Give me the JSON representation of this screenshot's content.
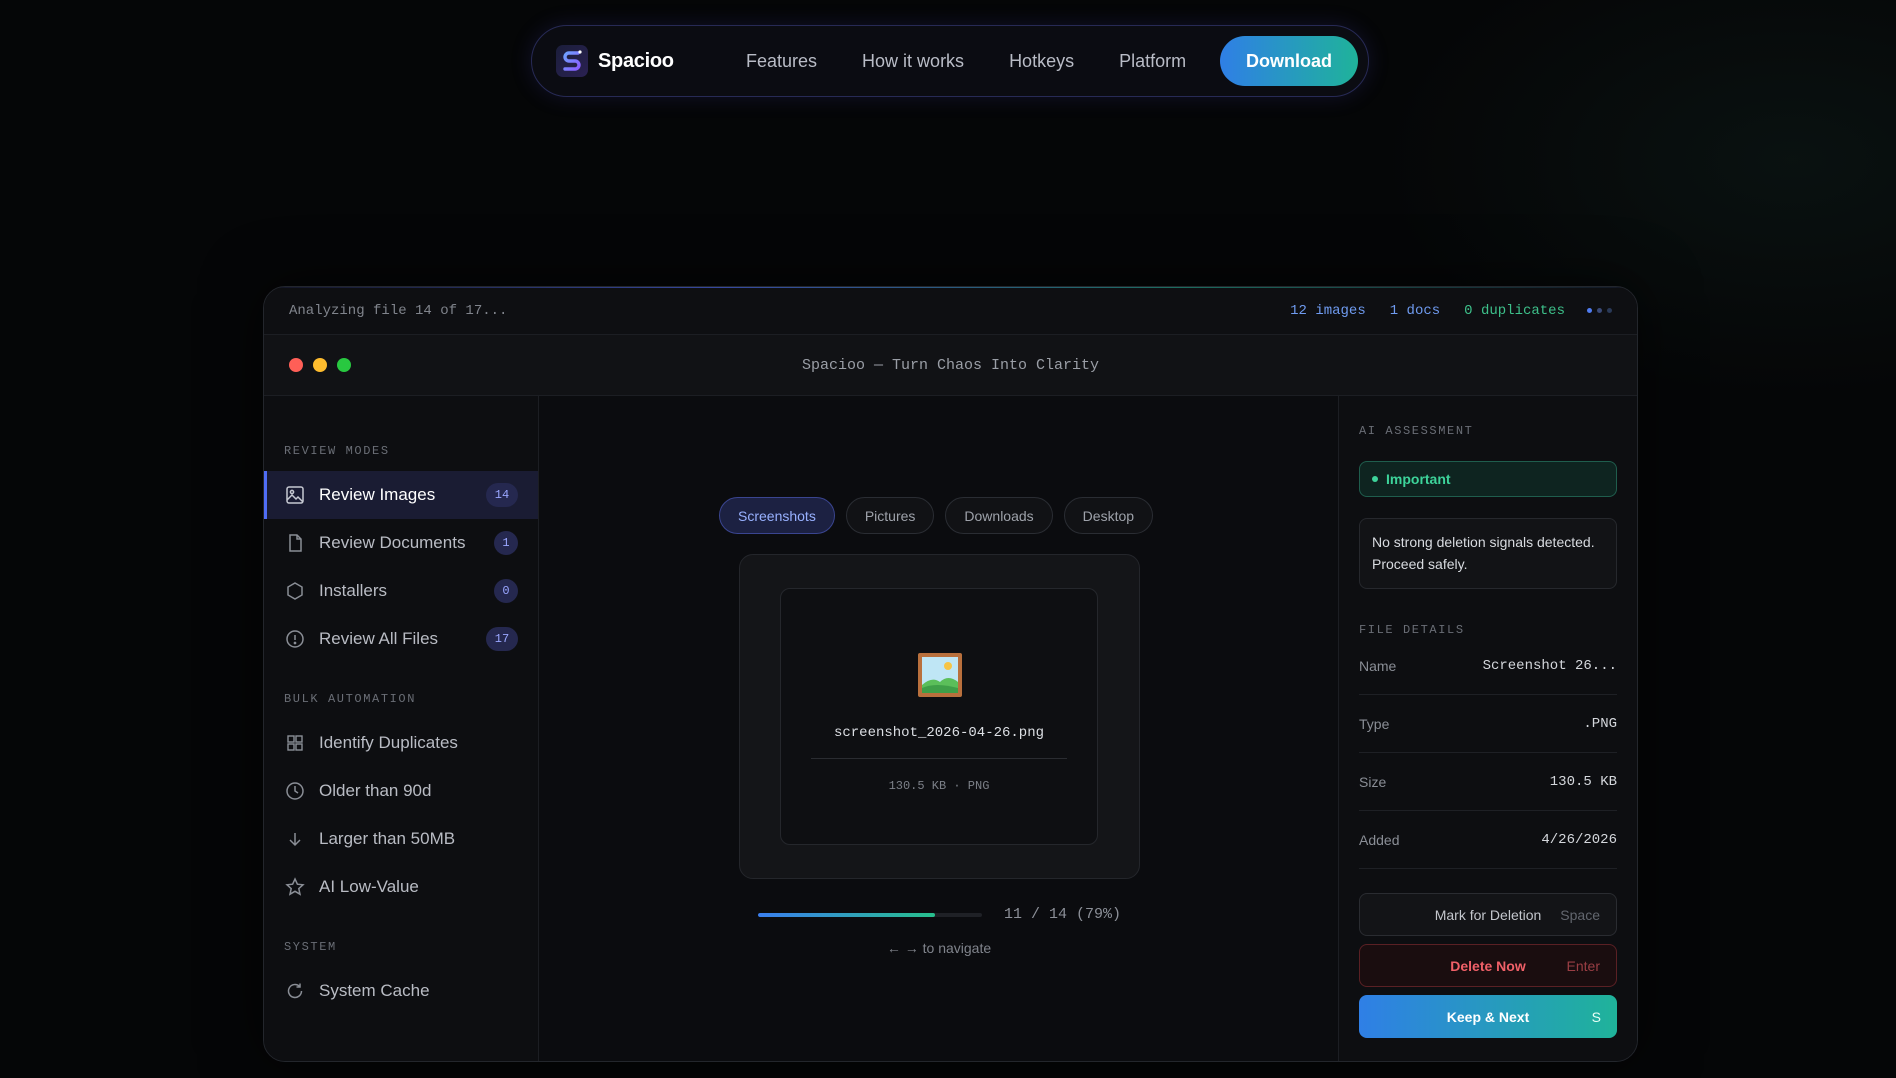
{
  "nav": {
    "brand": "Spacioo",
    "links": [
      "Features",
      "How it works",
      "Hotkeys",
      "Platform"
    ],
    "download_label": "Download"
  },
  "status": {
    "text": "Analyzing file 14 of 17...",
    "images": "12 images",
    "docs": "1 docs",
    "duplicates": "0 duplicates"
  },
  "window": {
    "title": "Spacioo — Turn Chaos Into Clarity"
  },
  "sidebar": {
    "review_modes_label": "REVIEW MODES",
    "review_items": [
      {
        "label": "Review Images",
        "count": "14",
        "icon": "image-icon"
      },
      {
        "label": "Review Documents",
        "count": "1",
        "icon": "document-icon"
      },
      {
        "label": "Installers",
        "count": "0",
        "icon": "hexagon-icon"
      },
      {
        "label": "Review All Files",
        "count": "17",
        "icon": "alert-circle-icon"
      }
    ],
    "bulk_label": "BULK AUTOMATION",
    "bulk_items": [
      {
        "label": "Identify Duplicates",
        "icon": "grid-icon"
      },
      {
        "label": "Older than 90d",
        "icon": "clock-icon"
      },
      {
        "label": "Larger than 50MB",
        "icon": "arrow-down-icon"
      },
      {
        "label": "AI Low-Value",
        "icon": "star-icon"
      }
    ],
    "system_label": "SYSTEM",
    "system_items": [
      {
        "label": "System Cache",
        "icon": "refresh-icon"
      }
    ]
  },
  "main": {
    "chips": [
      "Screenshots",
      "Pictures",
      "Downloads",
      "Desktop"
    ],
    "active_chip": "Screenshots",
    "file_name": "screenshot_2026-04-26.png",
    "file_meta": "130.5 KB · PNG",
    "progress_fraction": 0.79,
    "progress_text": "11 / 14 (79%)",
    "nav_hint": "← → to navigate"
  },
  "panel": {
    "ai_label": "AI ASSESSMENT",
    "assessment_badge": "Important",
    "assessment_text": "No strong deletion signals detected. Proceed safely.",
    "details_label": "FILE DETAILS",
    "details": [
      {
        "key": "Name",
        "value": "Screenshot 26..."
      },
      {
        "key": "Type",
        "value": ".PNG"
      },
      {
        "key": "Size",
        "value": "130.5 KB"
      },
      {
        "key": "Added",
        "value": "4/26/2026"
      }
    ],
    "actions": {
      "mark": {
        "label": "Mark for Deletion",
        "key": "Space"
      },
      "delete": {
        "label": "Delete Now",
        "key": "Enter"
      },
      "keep": {
        "label": "Keep & Next",
        "key": "S"
      }
    }
  },
  "colors": {
    "accent_blue": "#2f7fe6",
    "accent_teal": "#1fb39a",
    "danger": "#f06068",
    "success": "#3dd39a"
  }
}
